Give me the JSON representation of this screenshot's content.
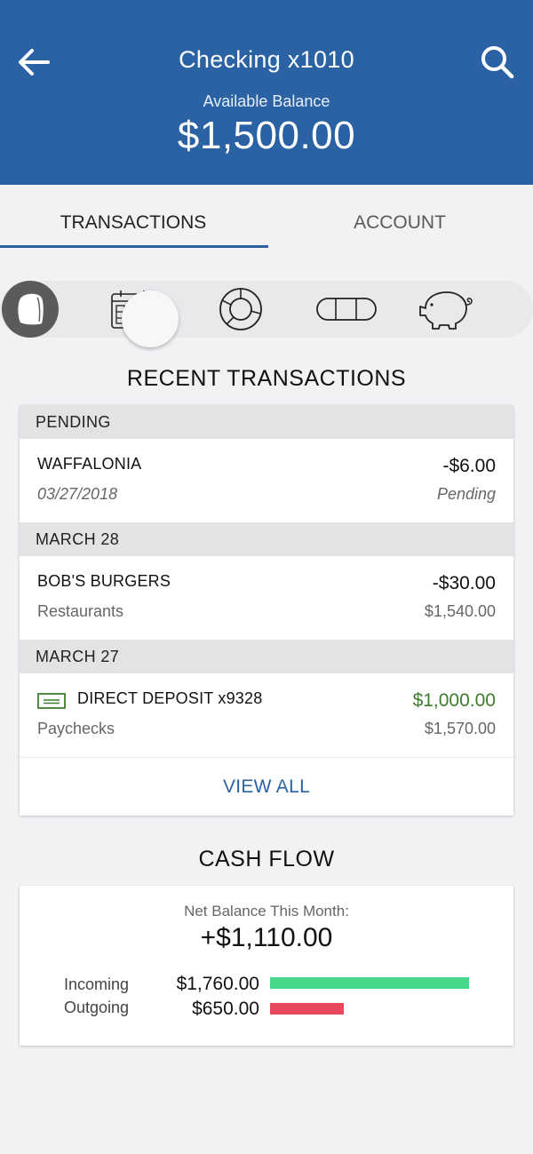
{
  "header": {
    "title": "Checking x1010",
    "balance_label": "Available Balance",
    "balance_value": "$1,500.00",
    "back_icon": "arrow-left-icon",
    "search_icon": "search-icon",
    "color": "#2a62a3"
  },
  "tabs": [
    {
      "label": "TRANSACTIONS",
      "active": true
    },
    {
      "label": "ACCOUNT",
      "active": false
    }
  ],
  "icon_strip": {
    "items": [
      "bubble-icon",
      "calendar-icon",
      "donut-chart-icon",
      "pill-toggle-icon",
      "piggy-bank-icon"
    ],
    "selected": "bubble-icon"
  },
  "recent": {
    "title": "RECENT TRANSACTIONS",
    "groups": [
      {
        "header": "PENDING",
        "items": [
          {
            "name": "WAFFALONIA",
            "sub": "03/27/2018",
            "amount": "-$6.00",
            "right_sub": "Pending"
          }
        ]
      },
      {
        "header": "MARCH 28",
        "items": [
          {
            "name": "BOB'S BURGERS",
            "sub": "Restaurants",
            "amount": "-$30.00",
            "right_sub": "$1,540.00"
          }
        ]
      },
      {
        "header": "MARCH 27",
        "items": [
          {
            "name": "DIRECT DEPOSIT x9328",
            "sub": "Paychecks",
            "amount": "$1,000.00",
            "right_sub": "$1,570.00",
            "icon": "check-deposit-icon"
          }
        ]
      }
    ],
    "view_all": "VIEW ALL"
  },
  "cash_flow": {
    "title": "CASH FLOW",
    "net_label": "Net Balance This Month:",
    "net_value": "+$1,110.00",
    "incoming_label": "Incoming",
    "incoming_amount": "$1,760.00",
    "incoming_fraction": 1.0,
    "incoming_color": "#47d68a",
    "outgoing_label": "Outgoing",
    "outgoing_amount": "$650.00",
    "outgoing_fraction": 0.369,
    "outgoing_color": "#e8485e"
  }
}
